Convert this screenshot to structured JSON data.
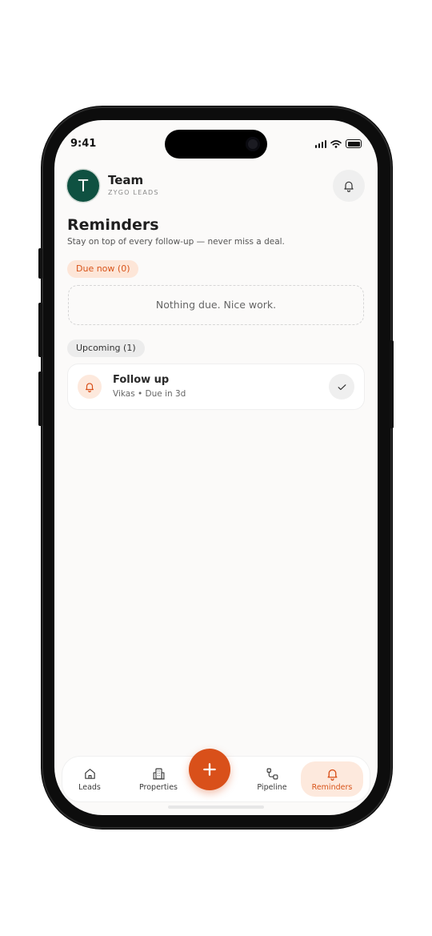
{
  "status_bar": {
    "time": "9:41"
  },
  "header": {
    "avatar_initial": "T",
    "team_name": "Team",
    "team_subtitle": "ZYGO LEADS",
    "notification_icon": "bell-icon"
  },
  "page": {
    "title": "Reminders",
    "subtitle": "Stay on top of every follow-up — never miss a deal."
  },
  "due_now": {
    "label": "Due now (0)",
    "empty_message": "Nothing due. Nice work."
  },
  "upcoming": {
    "label": "Upcoming (1)",
    "items": [
      {
        "title": "Follow up",
        "meta": "Vikas • Due in 3d",
        "icon": "bell-icon",
        "action_icon": "check-icon"
      }
    ]
  },
  "bottom_nav": {
    "items": [
      {
        "label": "Leads",
        "icon": "home-icon",
        "active": false
      },
      {
        "label": "Properties",
        "icon": "building-icon",
        "active": false
      },
      {
        "label": "Pipeline",
        "icon": "pipeline-icon",
        "active": false
      },
      {
        "label": "Reminders",
        "icon": "bell-icon",
        "active": true
      }
    ],
    "fab_icon": "plus-icon"
  },
  "colors": {
    "accent": "#d9501a",
    "accent_soft": "#fde9dd",
    "avatar_bg": "#0f5141"
  }
}
